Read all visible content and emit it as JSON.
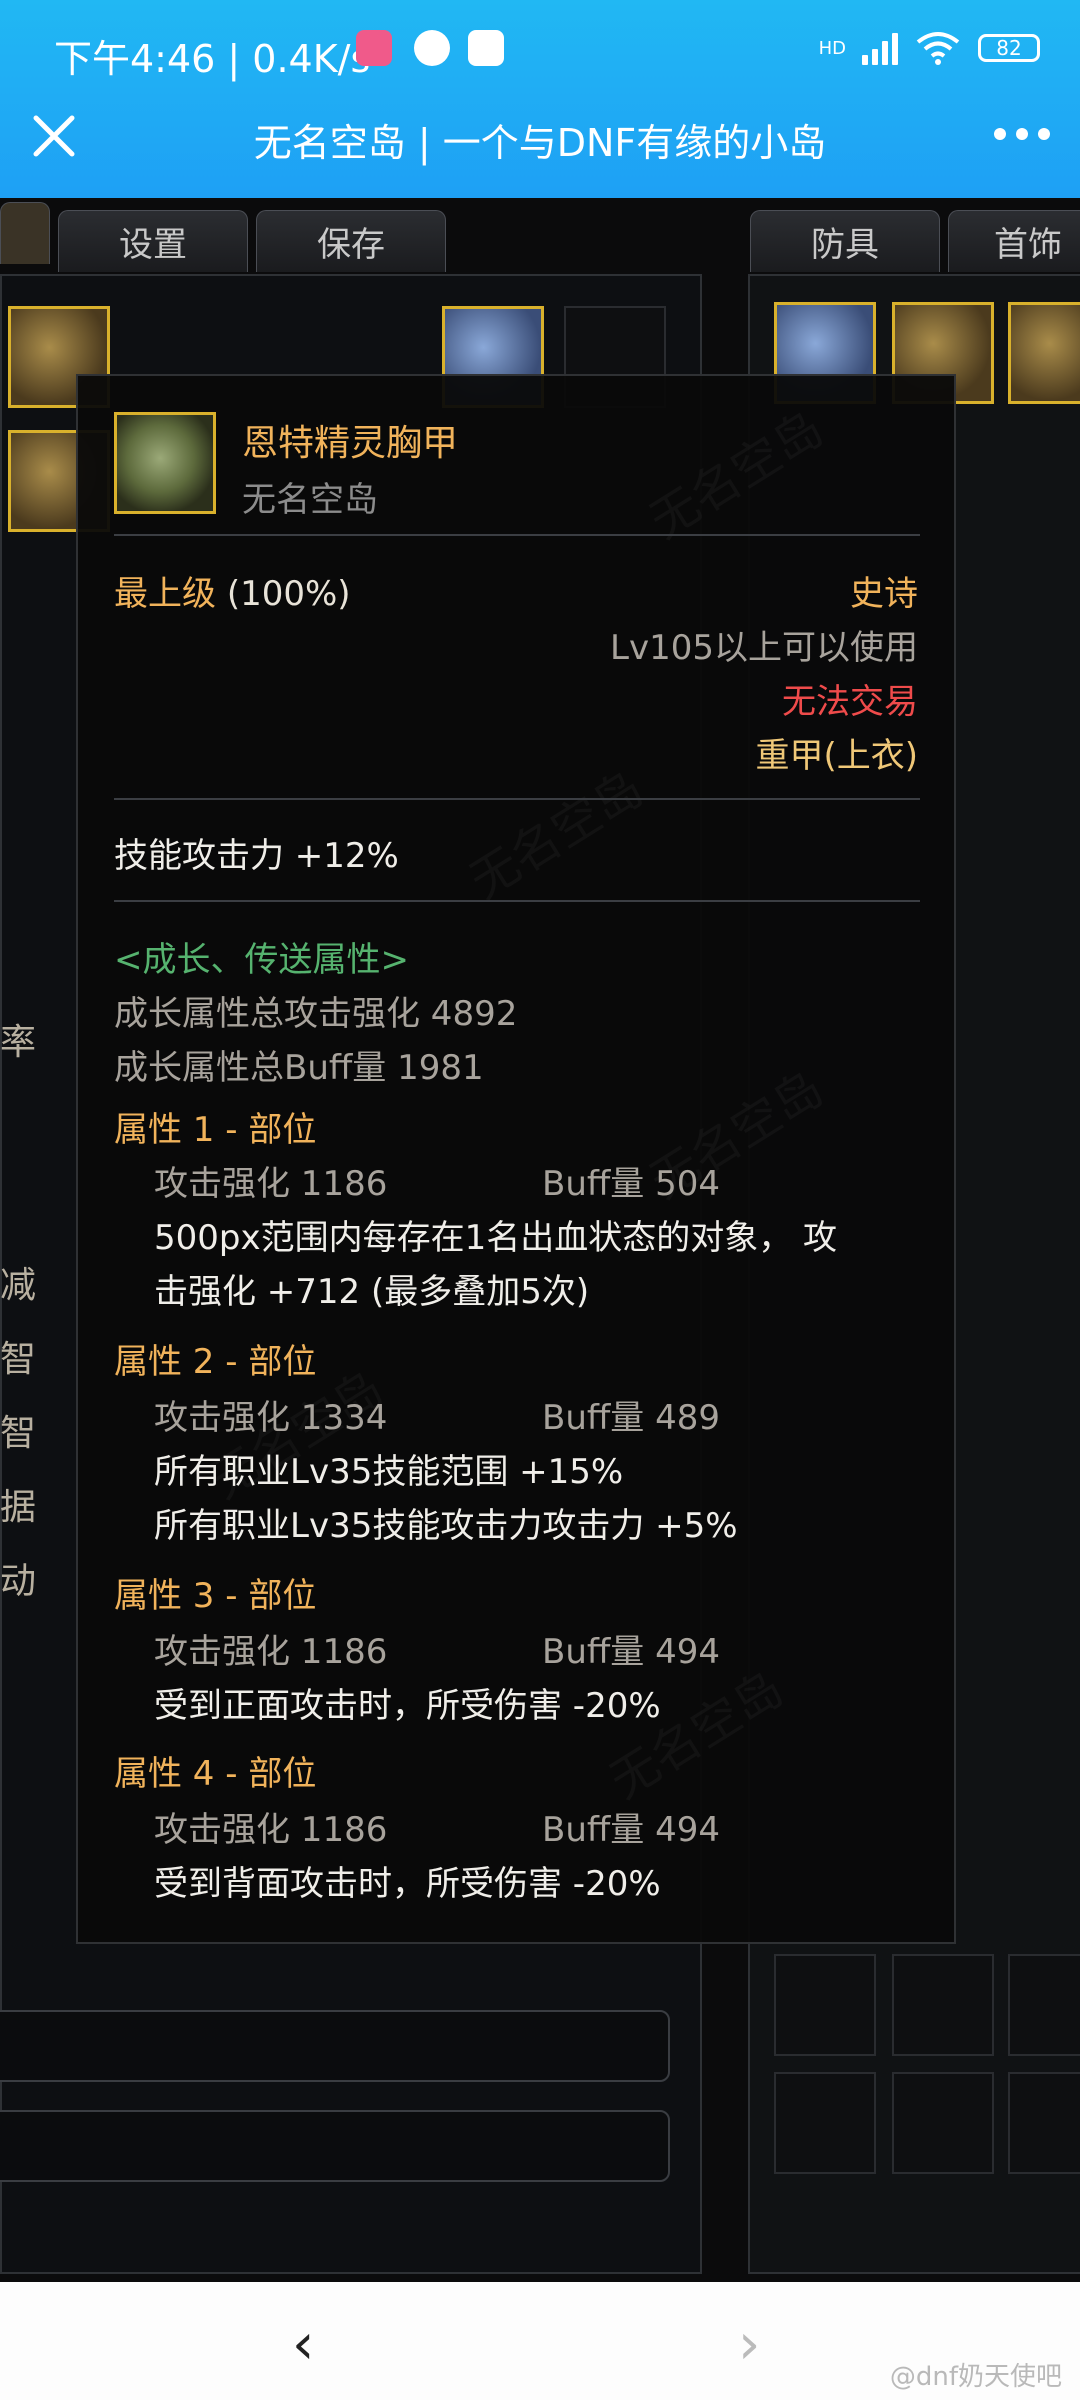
{
  "status": {
    "time_speed": "下午4:46 | 0.4K/s",
    "network": "HD",
    "battery": "82"
  },
  "header": {
    "title": "无名空岛 | 一个与DNF有缘的小岛"
  },
  "left_tabs": [
    "设置",
    "保存"
  ],
  "right_tabs": [
    "防具",
    "首饰"
  ],
  "left_side_chars": [
    "率",
    "减",
    "智",
    "智",
    "据",
    "动"
  ],
  "save_button": "保存",
  "tooltip": {
    "item_name": "恩特精灵胸甲",
    "author": "无名空岛",
    "grade_label": "最上级",
    "grade_pct": "(100%)",
    "rarity": "史诗",
    "level_req": "Lv105以上可以使用",
    "trade": "无法交易",
    "slot_type": "重甲(上衣)",
    "skill_atk": "技能攻击力  +12%",
    "growth_header": "<成长、传送属性>",
    "growth_total_atk": "成长属性总攻击强化 4892",
    "growth_total_buff": "成长属性总Buff量 1981",
    "attributes": [
      {
        "title": "属性 1 - 部位",
        "atk": "攻击强化   1186",
        "buff": "Buff量   504",
        "effects": [
          "500px范围内每存在1名出血状态的对象， 攻",
          "击强化 +712 (最多叠加5次)"
        ]
      },
      {
        "title": "属性 2 - 部位",
        "atk": "攻击强化   1334",
        "buff": "Buff量   489",
        "effects": [
          "所有职业Lv35技能范围 +15%",
          "所有职业Lv35技能攻击力攻击力 +5%"
        ]
      },
      {
        "title": "属性 3 - 部位",
        "atk": "攻击强化   1186",
        "buff": "Buff量   494",
        "effects": [
          "受到正面攻击时，所受伤害 -20%"
        ]
      },
      {
        "title": "属性 4 - 部位",
        "atk": "攻击强化   1186",
        "buff": "Buff量   494",
        "effects": [
          "受到背面攻击时，所受伤害 -20%"
        ]
      }
    ],
    "watermark": "无名空岛"
  },
  "bottom": {
    "back": "‹",
    "forward": "›",
    "watermark": "@dnf奶天使吧"
  }
}
